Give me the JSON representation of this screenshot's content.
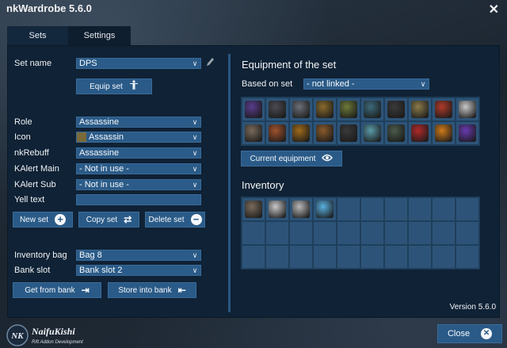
{
  "window": {
    "title": "nkWardrobe 5.6.0",
    "close_icon": "close-icon"
  },
  "tabs": [
    {
      "label": "Sets"
    },
    {
      "label": "Settings"
    }
  ],
  "left": {
    "set_name_label": "Set name",
    "set_name_value": "DPS",
    "equip_set_label": "Equip set",
    "role_label": "Role",
    "role_value": "Assassine",
    "icon_label": "Icon",
    "icon_value": "Assassin",
    "rebuff_label": "nkRebuff",
    "rebuff_value": "Assassine",
    "kalert_main_label": "KAlert Main",
    "kalert_main_value": "- Not in use -",
    "kalert_sub_label": "KAlert Sub",
    "kalert_sub_value": "- Not in use -",
    "yell_label": "Yell text",
    "yell_value": "",
    "new_set_label": "New set",
    "copy_set_label": "Copy set",
    "delete_set_label": "Delete set",
    "bag_label": "Inventory bag",
    "bag_value": "Bag 8",
    "bank_slot_label": "Bank slot",
    "bank_slot_value": "Bank slot 2",
    "get_bank_label": "Get from bank",
    "store_bank_label": "Store into bank"
  },
  "right": {
    "equipment_title": "Equipment of the set",
    "based_on_label": "Based on set",
    "based_on_value": "- not linked -",
    "equip_items": [
      {
        "icon": "staff-icon",
        "color": "#5a3c8c"
      },
      {
        "icon": "bracer-icon",
        "color": "#4a4a52"
      },
      {
        "icon": "helm-icon",
        "color": "#6b6f78"
      },
      {
        "icon": "glove-icon",
        "color": "#8a6a2a"
      },
      {
        "icon": "dagger-icon",
        "color": "#6e7a3a"
      },
      {
        "icon": "belt-icon",
        "color": "#3c6a7a"
      },
      {
        "icon": "chest-icon",
        "color": "#3a3a3a"
      },
      {
        "icon": "boot-icon",
        "color": "#8a7a4a"
      },
      {
        "icon": "orb-icon",
        "color": "#b03a2a"
      },
      {
        "icon": "blade-icon",
        "color": "#c8c8c8"
      },
      {
        "icon": "axe-icon",
        "color": "#7a6a5a"
      },
      {
        "icon": "scimitar-icon",
        "color": "#a0522d"
      },
      {
        "icon": "ring-icon",
        "color": "#a06a1a"
      },
      {
        "icon": "ring2-icon",
        "color": "#8a5a2a"
      },
      {
        "icon": "spider-icon",
        "color": "#3a3a3a"
      },
      {
        "icon": "crystal-icon",
        "color": "#5a9aa8"
      },
      {
        "icon": "shoulder-icon",
        "color": "#4a5a4a"
      },
      {
        "icon": "gem-red-icon",
        "color": "#b02a2a"
      },
      {
        "icon": "gem-orange-icon",
        "color": "#d07a1a"
      },
      {
        "icon": "swirl-icon",
        "color": "#6a3ab0"
      }
    ],
    "current_equipment_label": "Current equipment",
    "inventory_title": "Inventory",
    "inventory_items": [
      {
        "icon": "axe-icon",
        "color": "#7a6a5a"
      },
      {
        "icon": "blade-icon",
        "color": "#c8c8c8"
      },
      {
        "icon": "blade-icon",
        "color": "#b8b8b8"
      },
      {
        "icon": "crystal-blade-icon",
        "color": "#5ab0e0"
      }
    ],
    "version": "Version 5.6.0"
  },
  "footer": {
    "logo_text": "NaifuKishi",
    "logo_sub": "Rift Addon Development",
    "logo_mark": "NK",
    "close_label": "Close"
  }
}
